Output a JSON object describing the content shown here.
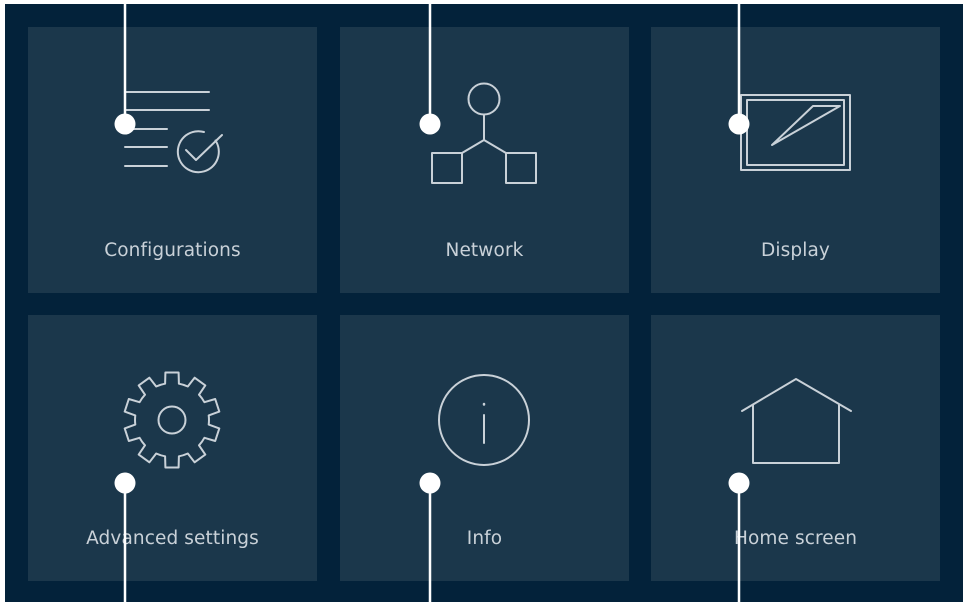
{
  "menu": {
    "tiles": [
      {
        "label": "Configurations",
        "icon": "configurations-icon"
      },
      {
        "label": "Network",
        "icon": "network-icon"
      },
      {
        "label": "Display",
        "icon": "display-icon"
      },
      {
        "label": "Advanced settings",
        "icon": "gear-icon"
      },
      {
        "label": "Info",
        "icon": "info-icon"
      },
      {
        "label": "Home screen",
        "icon": "home-icon"
      }
    ]
  },
  "colors": {
    "panel_background": "#03223a",
    "tile_background": "#1b374b",
    "icon_stroke": "#c9d1d8",
    "label_text": "#c9d1d8",
    "callout": "#ffffff"
  }
}
